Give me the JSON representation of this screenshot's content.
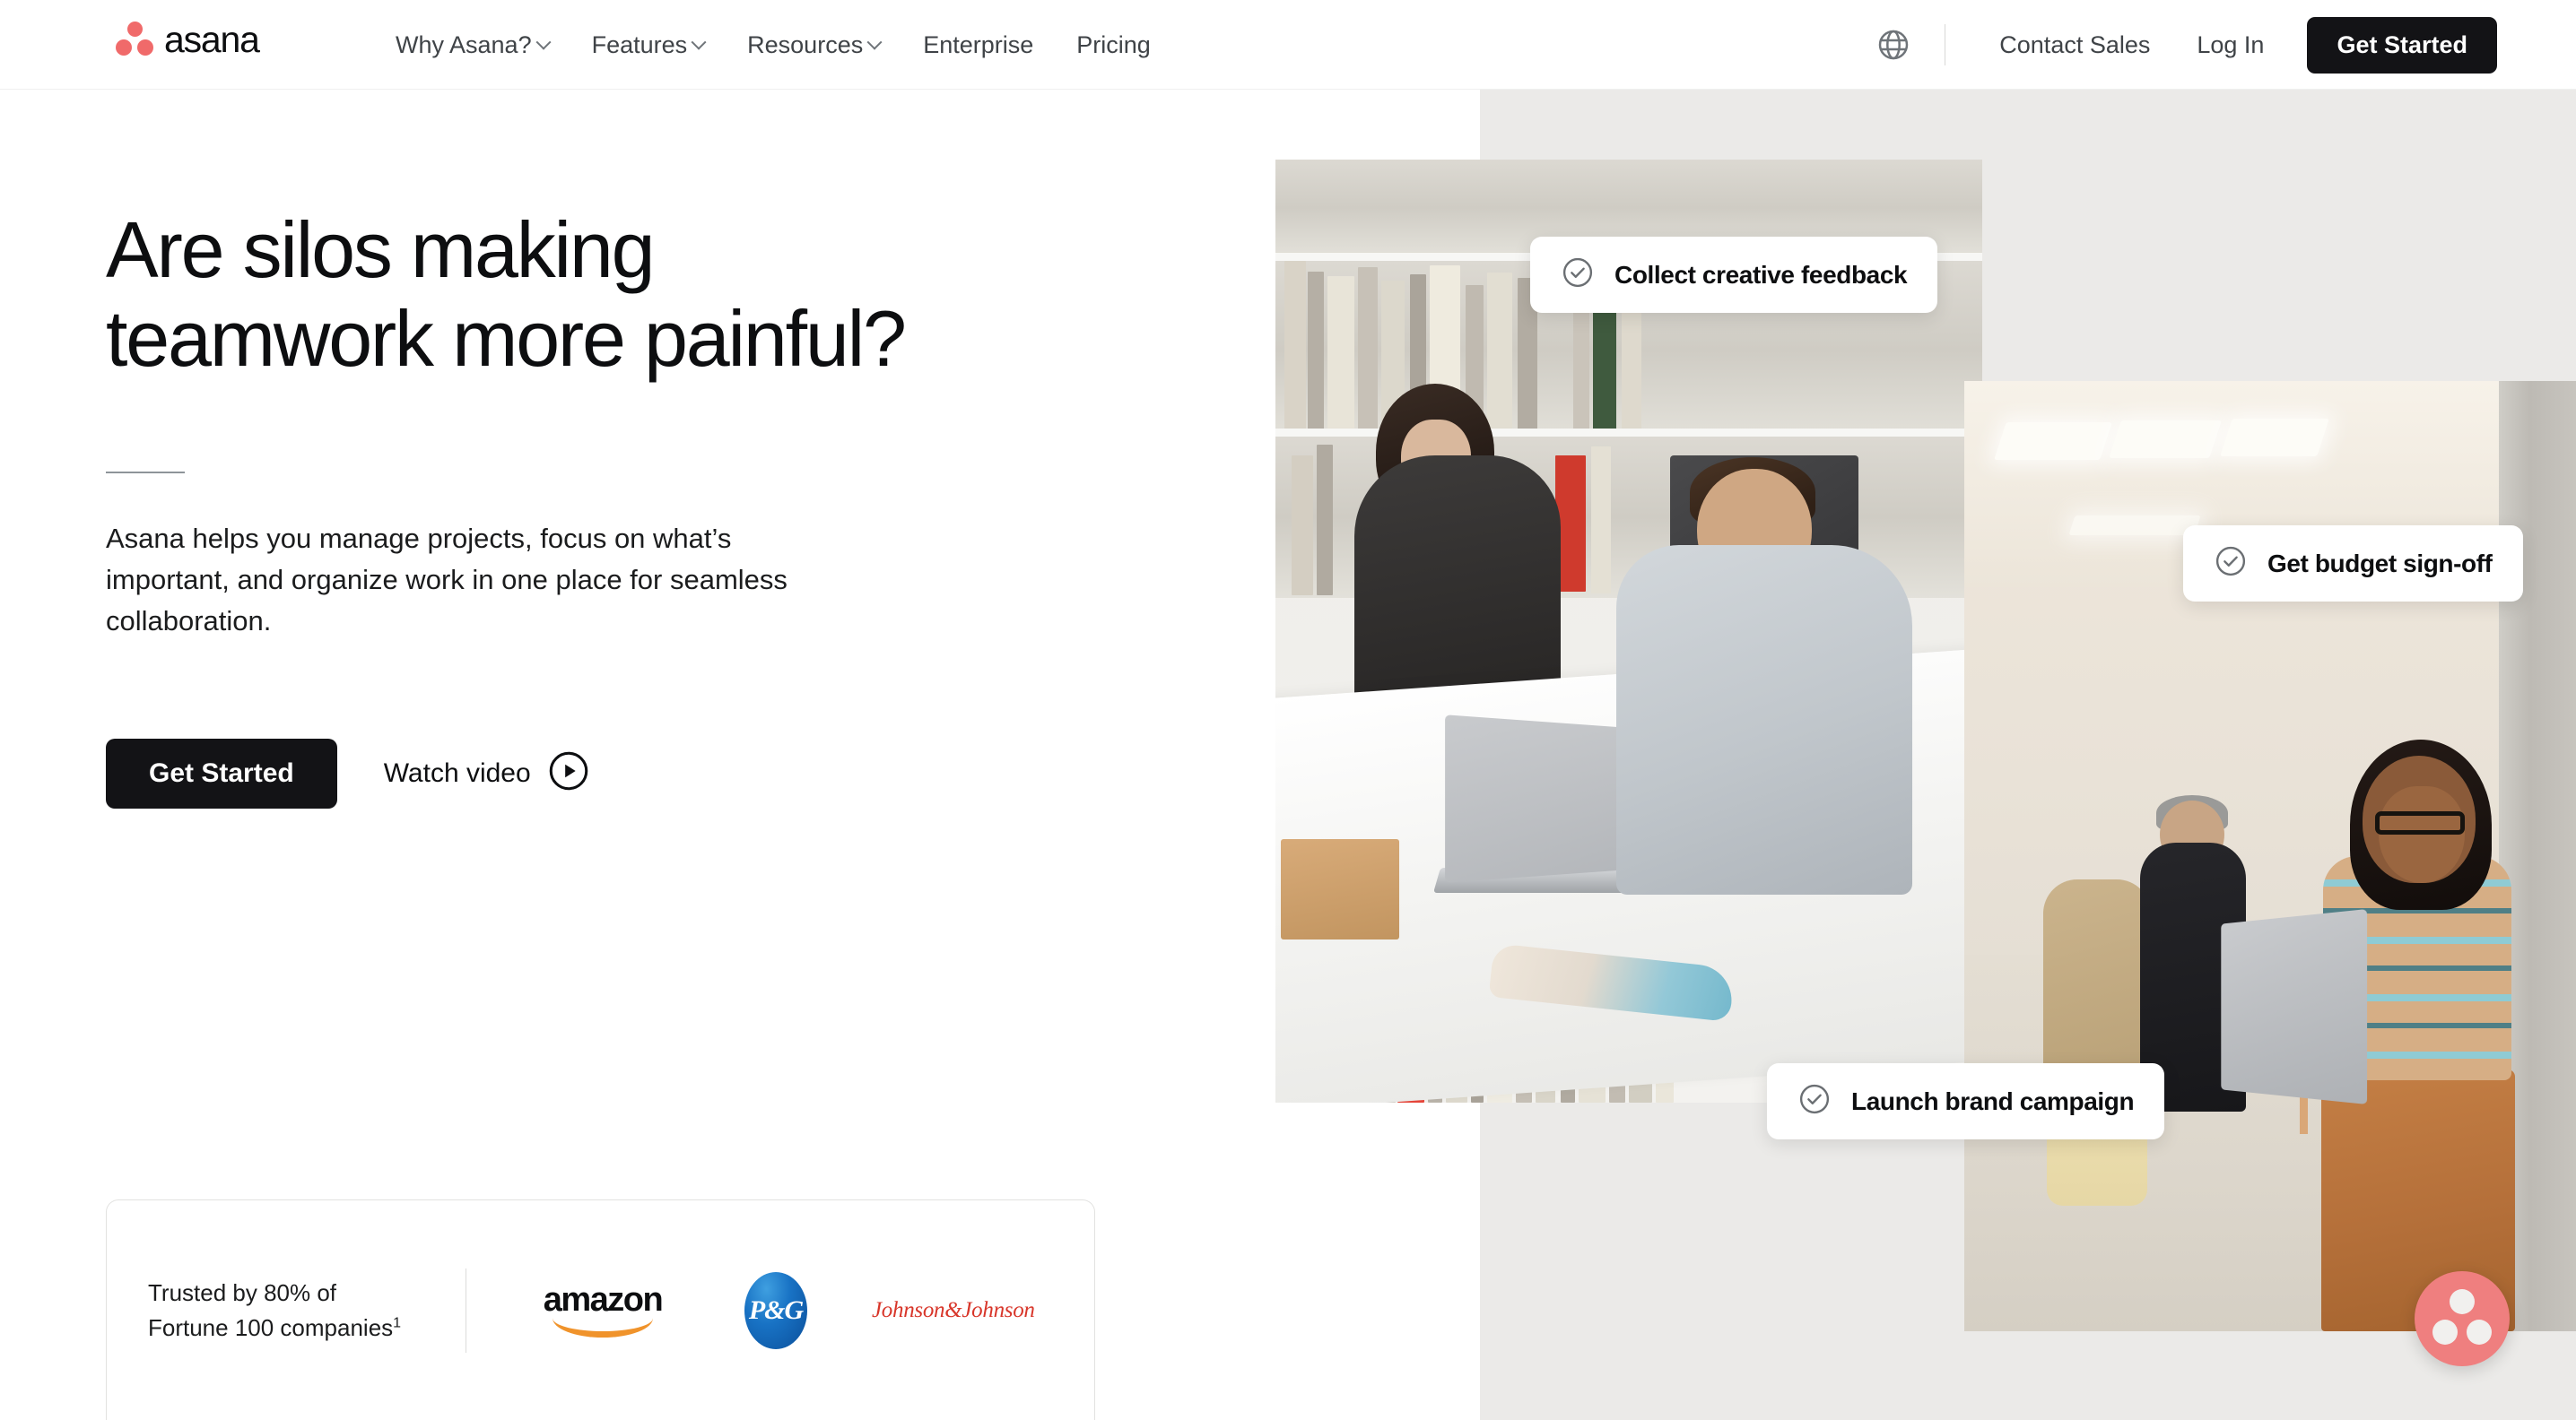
{
  "brand": {
    "name": "asana",
    "logo_icon": "asana-logo-icon",
    "accent_color": "#f06a6a",
    "dark_color": "#131316"
  },
  "header": {
    "nav": [
      {
        "label": "Why Asana?",
        "has_dropdown": true
      },
      {
        "label": "Features",
        "has_dropdown": true
      },
      {
        "label": "Resources",
        "has_dropdown": true
      },
      {
        "label": "Enterprise",
        "has_dropdown": false
      },
      {
        "label": "Pricing",
        "has_dropdown": false
      }
    ],
    "language_icon": "globe-icon",
    "contact_sales": "Contact Sales",
    "log_in": "Log In",
    "get_started": "Get Started"
  },
  "hero": {
    "headline": "Are silos making teamwork more painful?",
    "subcopy": "Asana helps you manage projects, focus on what’s important, and organize work in one place for seamless collaboration.",
    "cta_primary": "Get Started",
    "cta_video": "Watch video",
    "video_icon": "play-circle-icon"
  },
  "pills": [
    {
      "label": "Collect creative feedback",
      "icon": "check-circle-icon"
    },
    {
      "label": "Get budget sign-off",
      "icon": "check-circle-icon"
    },
    {
      "label": "Launch brand campaign",
      "icon": "check-circle-icon"
    }
  ],
  "trust": {
    "line1": "Trusted by 80% of",
    "line2": "Fortune 100 companies",
    "footnote": "1",
    "logos": [
      {
        "name": "amazon",
        "wordmark": "amazon"
      },
      {
        "name": "procter-and-gamble",
        "wordmark": "P&G"
      },
      {
        "name": "johnson-and-johnson",
        "wordmark": "Johnson&Johnson"
      }
    ]
  },
  "chat": {
    "icon": "asana-chat-icon"
  }
}
